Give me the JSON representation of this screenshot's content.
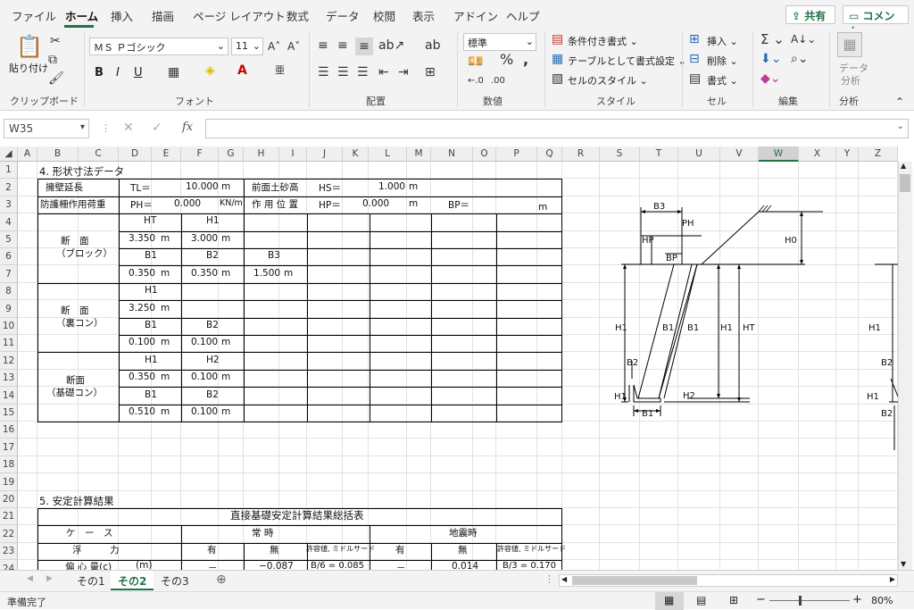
{
  "menu": {
    "tabs": [
      "ファイル",
      "ホーム",
      "挿入",
      "描画",
      "ページ レイアウト",
      "数式",
      "データ",
      "校閲",
      "表示",
      "アドイン",
      "ヘルプ"
    ],
    "share": "共有",
    "comment": "コメント"
  },
  "ribbon": {
    "clipboard": {
      "paste": "貼り付け",
      "label": "クリップボード"
    },
    "font": {
      "name": "ＭＳ Ｐゴシック",
      "size": "11",
      "bold": "B",
      "italic": "I",
      "underline": "U",
      "label": "フォント"
    },
    "alignment": {
      "label": "配置"
    },
    "number": {
      "format": "標準",
      "label": "数値"
    },
    "styles": {
      "conditional": "条件付き書式",
      "table": "テーブルとして書式設定",
      "cell": "セルのスタイル",
      "label": "スタイル"
    },
    "cells": {
      "insert": "挿入",
      "delete": "削除",
      "format": "書式",
      "label": "セル"
    },
    "editing": {
      "label": "編集"
    },
    "analysis": {
      "btn1": "データ",
      "btn2": "分析",
      "label": "分析"
    }
  },
  "formula": {
    "namebox": "W35",
    "value": ""
  },
  "columns": [
    "A",
    "B",
    "C",
    "D",
    "E",
    "F",
    "G",
    "H",
    "I",
    "J",
    "K",
    "L",
    "M",
    "N",
    "O",
    "P",
    "Q",
    "R",
    "S",
    "T",
    "U",
    "V",
    "W",
    "X",
    "Y",
    "Z"
  ],
  "rows": [
    "1",
    "2",
    "3",
    "4",
    "5",
    "6",
    "7",
    "8",
    "9",
    "10",
    "11",
    "12",
    "13",
    "14",
    "15",
    "16",
    "17",
    "18",
    "19",
    "20",
    "21",
    "22",
    "23",
    "24"
  ],
  "sheet": {
    "section4": "4. 形状寸法データ",
    "r2": {
      "a": "擁壁延長",
      "b": "TL＝",
      "c": "10.000",
      "d": "m",
      "e": "前面土砂高",
      "f": "HS＝",
      "g": "1.000",
      "h": "m"
    },
    "r3": {
      "a": "防護柵作用荷重",
      "b": "PH＝",
      "c": "0.000",
      "d": "KN/m",
      "e": "作 用 位 置",
      "f": "HP＝",
      "g": "0.000",
      "h": "m",
      "i": "BP＝",
      "j": "m"
    },
    "block": {
      "title1": "断　面",
      "title2": "（ブロック）",
      "HT": "HT",
      "H1": "H1",
      "v1": "3.350",
      "u1": "m",
      "v2": "3.000",
      "u2": "m",
      "B1": "B1",
      "B2": "B2",
      "B3": "B3",
      "v3": "0.350",
      "u3": "m",
      "v4": "0.350",
      "u4": "m",
      "v5": "1.500",
      "u5": "m"
    },
    "backcon": {
      "title1": "断　面",
      "title2": "（裏コン）",
      "H1": "H1",
      "v1": "3.250",
      "u1": "m",
      "B1": "B1",
      "B2": "B2",
      "v2": "0.100",
      "u2": "m",
      "v3": "0.100",
      "u3": "m"
    },
    "basecon": {
      "title1": "断面",
      "title2": "（基礎コン）",
      "H1": "H1",
      "H2": "H2",
      "v1": "0.350",
      "u1": "m",
      "v2": "0.100",
      "u2": "m",
      "B1": "B1",
      "B2": "B2",
      "v3": "0.510",
      "u3": "m",
      "v4": "0.100",
      "u4": "m"
    },
    "section5": "5. 安定計算結果",
    "summary": {
      "title": "直接基礎安定計算結果総括表",
      "case": "ケ　ー　ス",
      "normal": "常 時",
      "quake": "地震時",
      "float": "浮　　　力",
      "yes": "有",
      "no": "無",
      "allow": "許容値, ミドルサード",
      "ecc": "偏 心 量(c)",
      "unit": "(m)",
      "c1": "－",
      "c2": "−0.087",
      "c3": "B/6 = 0.085",
      "c4": "－",
      "c5": "0.014",
      "c6": "B/3 = 0.170"
    }
  },
  "diagram": {
    "B3": "B3",
    "PH": "PH",
    "HP": "HP",
    "BP": "BP",
    "H0": "H0",
    "H1": "H1",
    "HT": "HT",
    "B1": "B1",
    "B2": "B2",
    "H2": "H2"
  },
  "tabs": [
    "その1",
    "その2",
    "その3"
  ],
  "status": {
    "ready": "準備完了",
    "zoom": "80%"
  }
}
